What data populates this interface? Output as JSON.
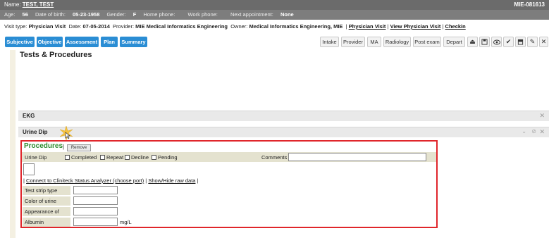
{
  "header": {
    "name_label": "Name:",
    "name": "TEST, TEST",
    "record_id": "MIE-081613"
  },
  "patient_info": [
    {
      "label": "Age:",
      "value": "56"
    },
    {
      "label": "Date of birth:",
      "value": "05-23-1958"
    },
    {
      "label": "Gender:",
      "value": "F"
    },
    {
      "label": "Home phone:",
      "value": ""
    },
    {
      "label": "Work phone:",
      "value": ""
    },
    {
      "label": "Next appointment:",
      "value": "None"
    }
  ],
  "visit": {
    "type_label": "Visit type:",
    "type": "Physician Visit",
    "date_label": "Date:",
    "date": "07-05-2014",
    "provider_label": "Provider:",
    "provider": "MIE Medical Informatics Engineering",
    "owner_label": "Owner:",
    "owner": "Medical Informatics Engineering, MIE",
    "links": [
      "Physician Visit",
      "View Physician Visit",
      "Checkin"
    ]
  },
  "nav_tabs": [
    "Subjective",
    "Objective",
    "Assessment",
    "Plan",
    "Summary"
  ],
  "right_buttons": [
    "Intake",
    "Provider",
    "MA",
    "Radiology",
    "Post exam",
    "Depart"
  ],
  "right_icons": [
    "eject-icon",
    "save-icon",
    "eye-icon",
    "checkmark-icon",
    "archive-icon",
    "edit-icon",
    "close-icon"
  ],
  "section_title": "Tests & Procedures",
  "sections": {
    "ekg": "EKG",
    "urine_dip": "Urine Dip"
  },
  "procedures": {
    "title": "Procedures",
    "remove": "Remove",
    "row_label": "Urine Dip",
    "status_options": [
      "Completed",
      "Repeat",
      "Decline",
      "Pending"
    ],
    "comments_label": "Comments",
    "comments_value": "",
    "connect_link": "Connect to Cliniteck Status Analyzer (choose port)",
    "raw_link": "Show/Hide raw data",
    "fields": [
      {
        "label": "Test strip type",
        "value": "",
        "unit": ""
      },
      {
        "label": "Color of urine",
        "value": "",
        "unit": ""
      },
      {
        "label": "Appearance of urine",
        "value": "",
        "unit": ""
      },
      {
        "label": "Albumin",
        "value": "",
        "unit": "mg/L"
      }
    ]
  },
  "colors": {
    "tab_blue": "#2a8dd4",
    "header_gray": "#6b6b6b",
    "highlight_red": "#e0262b",
    "procedures_green": "#2e8b2e"
  }
}
